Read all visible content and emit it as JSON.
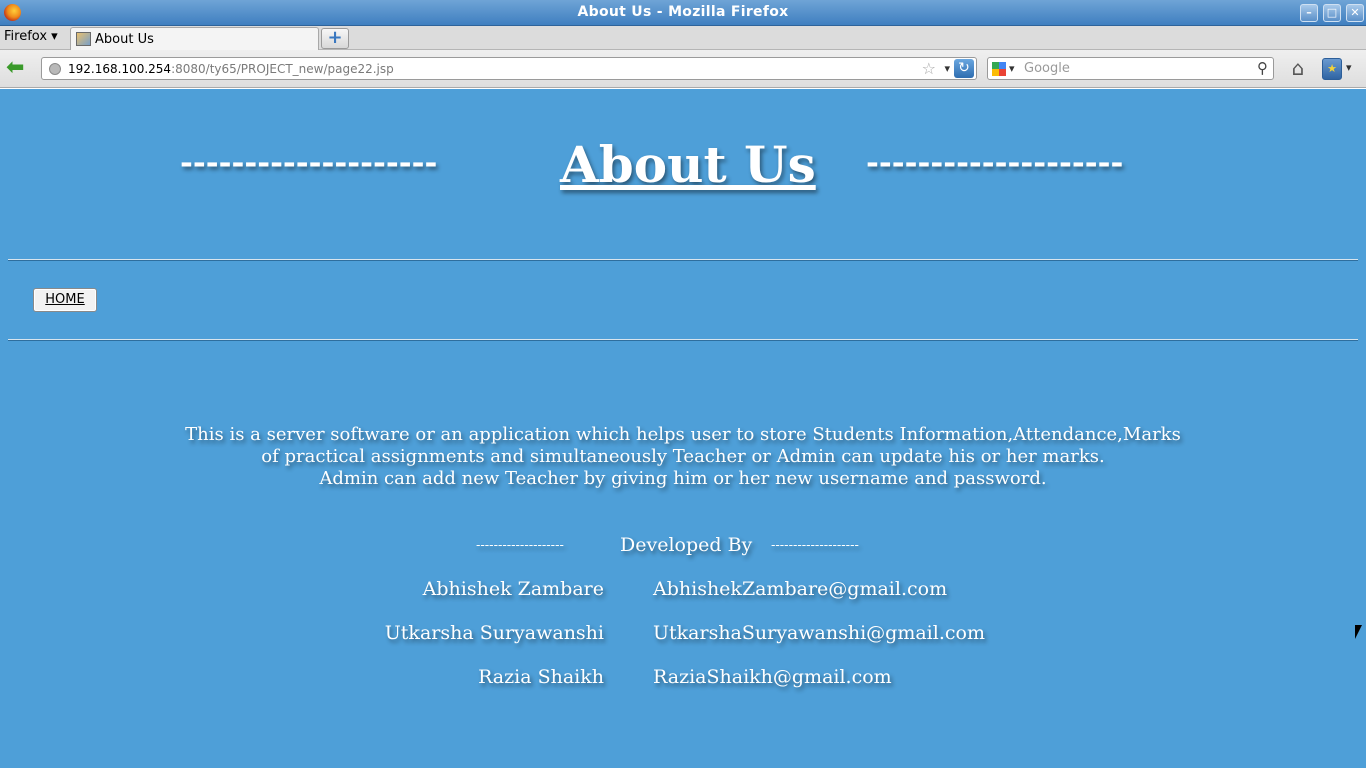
{
  "window": {
    "title": "About Us - Mozilla Firefox",
    "minimize_symbol": "–",
    "maximize_symbol": "□",
    "close_symbol": "✕"
  },
  "menu": {
    "label": "Firefox",
    "arrow": "▾"
  },
  "tabs": [
    {
      "label": "About Us"
    }
  ],
  "new_tab_symbol": "+",
  "nav": {
    "back_symbol": "⬅",
    "url_host": "192.168.100.254",
    "url_rest": ":8080/ty65/PROJECT_new/page22.jsp",
    "star_symbol": "☆",
    "dropdown_symbol": "▾",
    "reload_symbol": "↻",
    "search_placeholder": "Google",
    "search_symbol": "⚲",
    "home_symbol": "⌂",
    "bookmark_symbol": "★"
  },
  "page": {
    "dash_left": "--------------------",
    "title": "About Us",
    "dash_right": "--------------------",
    "home_button": "HOME",
    "about_lines": [
      "This is a server software or an application which helps user to store Students Information,Attendance,Marks",
      "of practical assignments and simultaneously Teacher or Admin can update his or her marks.",
      "Admin can add new Teacher by giving him or her new username and password."
    ],
    "developed_dash_left": "--------------------",
    "developed_by": "Developed By",
    "developed_dash_right": "--------------------",
    "developers": [
      {
        "name": "Abhishek Zambare",
        "email": "AbhishekZambare@gmail.com"
      },
      {
        "name": "Utkarsha Suryawanshi",
        "email": "UtkarshaSuryawanshi@gmail.com"
      },
      {
        "name": "Razia Shaikh",
        "email": "RaziaShaikh@gmail.com"
      }
    ]
  },
  "colors": {
    "page_background": "#4e9fd8",
    "titlebar": "#4f8ccb"
  }
}
